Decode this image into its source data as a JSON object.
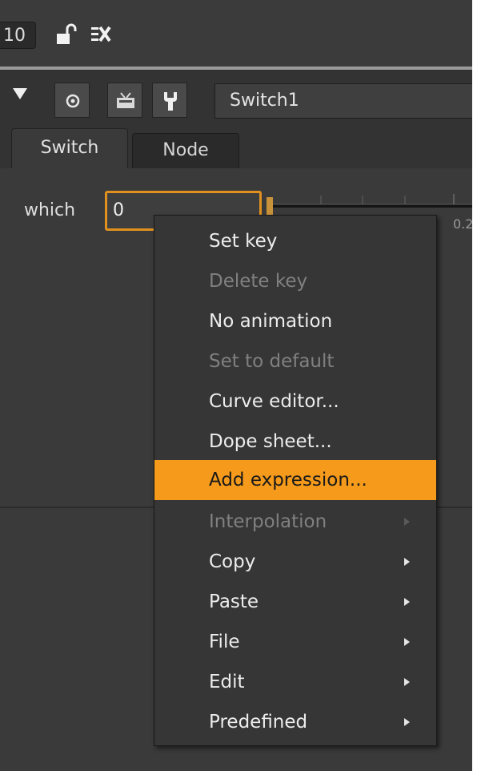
{
  "toolbar": {
    "frame_number": "10",
    "lock_icon": "lock-open-icon",
    "close_panels_icon": "close-all-panels-icon"
  },
  "node_header": {
    "collapse_icon": "triangle-down-icon",
    "buttons": [
      {
        "icon": "circle-target-icon"
      },
      {
        "icon": "viewer-icon"
      },
      {
        "icon": "wrench-icon"
      }
    ],
    "node_name": "Switch1"
  },
  "tabs": [
    {
      "label": "Switch",
      "active": true
    },
    {
      "label": "Node",
      "active": false
    }
  ],
  "knob": {
    "label": "which",
    "value": "0",
    "slider_tick_label": "0.2"
  },
  "context_menu": {
    "items": [
      {
        "label": "Set key",
        "enabled": true,
        "submenu": false,
        "highlighted": false
      },
      {
        "label": "Delete key",
        "enabled": false,
        "submenu": false,
        "highlighted": false
      },
      {
        "label": "No animation",
        "enabled": true,
        "submenu": false,
        "highlighted": false
      },
      {
        "label": "Set to default",
        "enabled": false,
        "submenu": false,
        "highlighted": false
      },
      {
        "label": "Curve editor...",
        "enabled": true,
        "submenu": false,
        "highlighted": false
      },
      {
        "label": "Dope sheet...",
        "enabled": true,
        "submenu": false,
        "highlighted": false
      },
      {
        "label": "Add expression...",
        "enabled": true,
        "submenu": false,
        "highlighted": true
      },
      {
        "label": "Interpolation",
        "enabled": false,
        "submenu": true,
        "highlighted": false
      },
      {
        "label": "Copy",
        "enabled": true,
        "submenu": true,
        "highlighted": false
      },
      {
        "label": "Paste",
        "enabled": true,
        "submenu": true,
        "highlighted": false
      },
      {
        "label": "File",
        "enabled": true,
        "submenu": true,
        "highlighted": false
      },
      {
        "label": "Edit",
        "enabled": true,
        "submenu": true,
        "highlighted": false
      },
      {
        "label": "Predefined",
        "enabled": true,
        "submenu": true,
        "highlighted": false
      }
    ]
  },
  "colors": {
    "accent": "#f59a1a",
    "field_focus_border": "#e0901f",
    "panel_bg": "#3a3a3a",
    "menu_bg": "#363636",
    "disabled_text": "#808080"
  }
}
